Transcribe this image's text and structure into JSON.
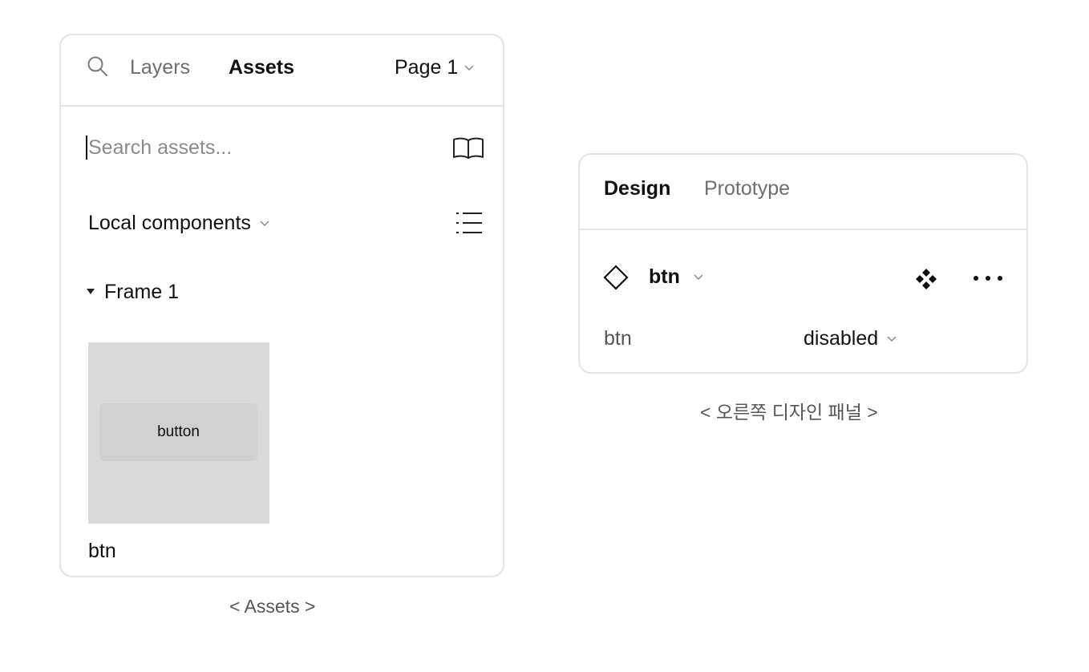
{
  "assets_panel": {
    "tabs": [
      "Layers",
      "Assets"
    ],
    "active_tab": "Assets",
    "page_label": "Page 1",
    "search": {
      "placeholder": "Search assets...",
      "value": ""
    },
    "library_label": "Local components",
    "section": {
      "label": "Frame 1",
      "expanded": true
    },
    "component": {
      "name": "btn",
      "thumbnail_text": "button"
    },
    "icons": [
      "search-icon",
      "chevron-down-icon",
      "book-icon",
      "list-view-icon",
      "caret-down-icon"
    ]
  },
  "design_panel": {
    "tabs": [
      "Design",
      "Prototype"
    ],
    "active_tab": "Design",
    "component_name": "btn",
    "property": {
      "name": "btn",
      "value": "disabled"
    },
    "icons": [
      "instance-icon",
      "chevron-down-icon",
      "component-icon",
      "more-icon"
    ]
  },
  "captions": {
    "assets": "< Assets >",
    "design": "< 오른쪽 디자인 패널 >"
  },
  "colors": {
    "border": "#e3e3e3",
    "thumbnail": "#d9d9d9",
    "text_muted": "#6e6e6e"
  }
}
